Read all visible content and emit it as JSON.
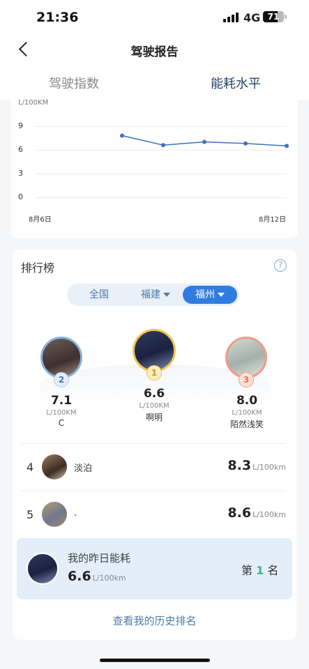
{
  "status": {
    "time": "21:36",
    "network": "4G",
    "battery": "71",
    "battery_level": 0.71
  },
  "nav": {
    "title": "驾驶报告"
  },
  "tabs": [
    {
      "label": "驾驶指数",
      "active": false
    },
    {
      "label": "能耗水平",
      "active": true
    }
  ],
  "colors": {
    "accent": "#25456b",
    "button": "#2f7de1",
    "line": "#3b72c0",
    "gold": "#f0c24b",
    "bronze": "#f29b87",
    "silver": "#8ab0dc"
  },
  "chart_data": {
    "type": "line",
    "ylabel": "L/100KM",
    "yticks": [
      0,
      3,
      6,
      9
    ],
    "ylim": [
      0,
      10
    ],
    "x": [
      "8月6日",
      "8月7日",
      "8月8日",
      "8月9日",
      "8月10日",
      "8月11日",
      "8月12日"
    ],
    "values": [
      null,
      null,
      7.8,
      6.6,
      7.0,
      6.8,
      6.5
    ],
    "xtick_labels": [
      "8月6日",
      "8月12日"
    ],
    "grid": true
  },
  "ranking": {
    "title": "排行榜",
    "help": "?",
    "filters": {
      "nation": "全国",
      "province": "福建",
      "city": "福州"
    },
    "unit_upper": "L/100KM",
    "podium": [
      {
        "rank": "2",
        "value": "7.1",
        "name": "C"
      },
      {
        "rank": "1",
        "value": "6.6",
        "name": "啊明"
      },
      {
        "rank": "3",
        "value": "8.0",
        "name": "陌然浅笑"
      }
    ],
    "unit_lower": "L/100km",
    "list": [
      {
        "rank": "4",
        "name": "淡泊",
        "value": "8.3"
      },
      {
        "rank": "5",
        "name": ".",
        "value": "8.6"
      }
    ],
    "mine": {
      "title": "我的昨日能耗",
      "value": "6.6",
      "rank_prefix": "第",
      "rank": "1",
      "rank_suffix": "名"
    },
    "history_link": "查看我的历史排名"
  }
}
